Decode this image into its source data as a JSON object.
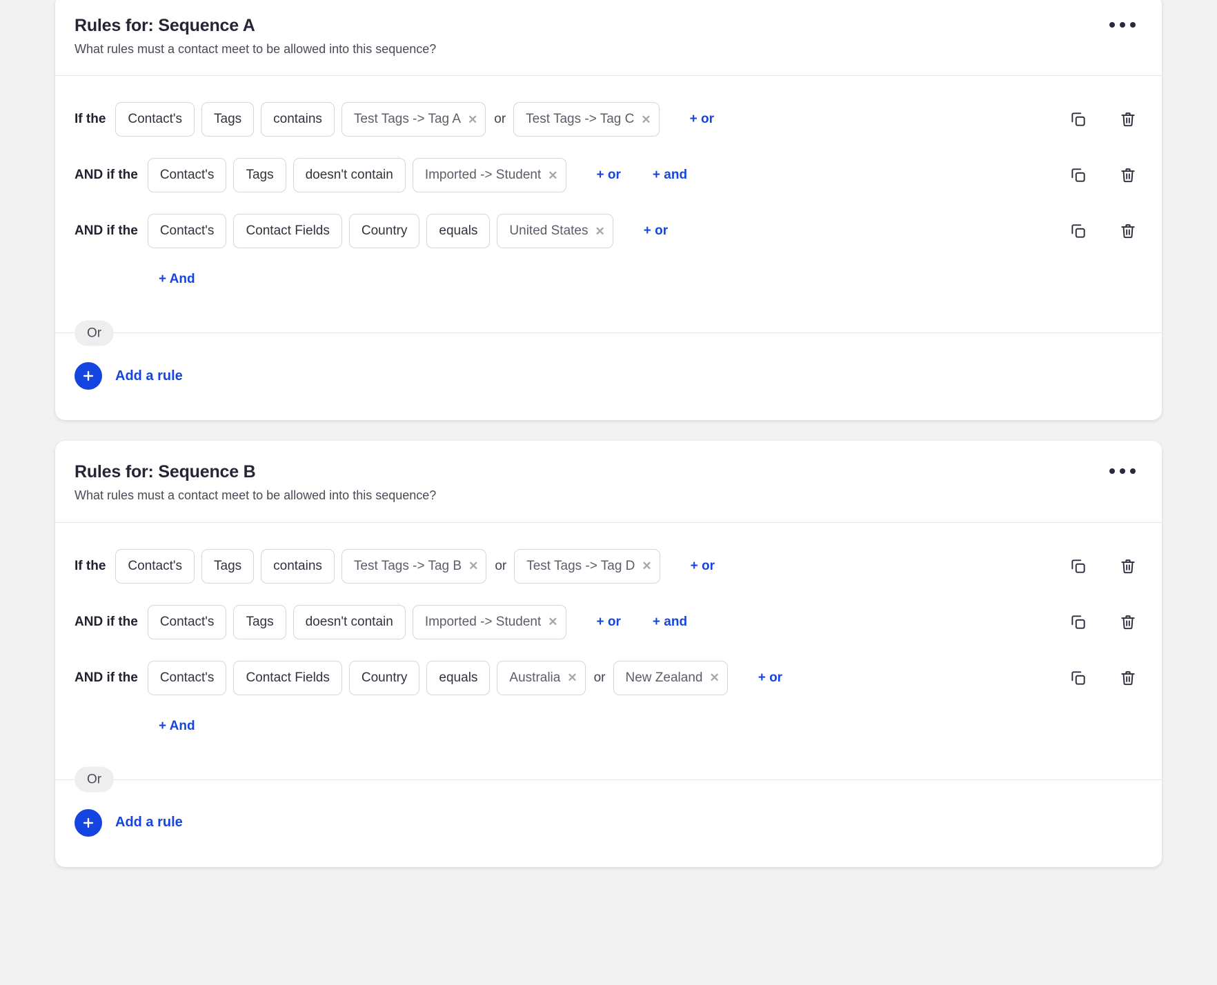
{
  "colors": {
    "accent": "#1545e0",
    "page_bg": "#f2f2f3",
    "card_bg": "#ffffff",
    "text": "#252535",
    "pill_border": "#d5d6dc",
    "or_badge_bg": "#eeeeef"
  },
  "icons": {
    "kebab": "kebab-menu-icon",
    "duplicate": "duplicate-icon",
    "delete": "trash-icon",
    "remove_chip": "✕",
    "plus": "plus-icon"
  },
  "common": {
    "if_the": "If the",
    "and_if_the": "AND if the",
    "or_separator": "or",
    "add_or": "+ or",
    "add_and": "+ and",
    "add_and_block": "+ And",
    "or_badge": "Or",
    "add_rule": "Add a rule",
    "subtitle": "What rules must a contact meet to be allowed into this sequence?"
  },
  "cards": [
    {
      "title": "Rules for: Sequence A",
      "subtitle": "What rules must a contact meet to be allowed into this sequence?",
      "rows": [
        {
          "conj": "If the",
          "pills": [
            "Contact's",
            "Tags",
            "contains"
          ],
          "values": [
            "Test Tags -> Tag A",
            "Test Tags -> Tag C"
          ],
          "links": [
            "+ or"
          ]
        },
        {
          "conj": "AND if the",
          "pills": [
            "Contact's",
            "Tags",
            "doesn't contain"
          ],
          "values": [
            "Imported -> Student"
          ],
          "links": [
            "+ or",
            "+ and"
          ]
        },
        {
          "conj": "AND if the",
          "pills": [
            "Contact's",
            "Contact Fields",
            "Country",
            "equals"
          ],
          "values": [
            "United States"
          ],
          "links": [
            "+ or"
          ]
        }
      ],
      "add_and": "+ And",
      "or_badge": "Or",
      "add_rule": "Add a rule"
    },
    {
      "title": "Rules for: Sequence B",
      "subtitle": "What rules must a contact meet to be allowed into this sequence?",
      "rows": [
        {
          "conj": "If the",
          "pills": [
            "Contact's",
            "Tags",
            "contains"
          ],
          "values": [
            "Test Tags -> Tag B",
            "Test Tags -> Tag D"
          ],
          "links": [
            "+ or"
          ]
        },
        {
          "conj": "AND if the",
          "pills": [
            "Contact's",
            "Tags",
            "doesn't contain"
          ],
          "values": [
            "Imported -> Student"
          ],
          "links": [
            "+ or",
            "+ and"
          ]
        },
        {
          "conj": "AND if the",
          "pills": [
            "Contact's",
            "Contact Fields",
            "Country",
            "equals"
          ],
          "values": [
            "Australia",
            "New Zealand"
          ],
          "links": [
            "+ or"
          ]
        }
      ],
      "add_and": "+ And",
      "or_badge": "Or",
      "add_rule": "Add a rule"
    }
  ]
}
